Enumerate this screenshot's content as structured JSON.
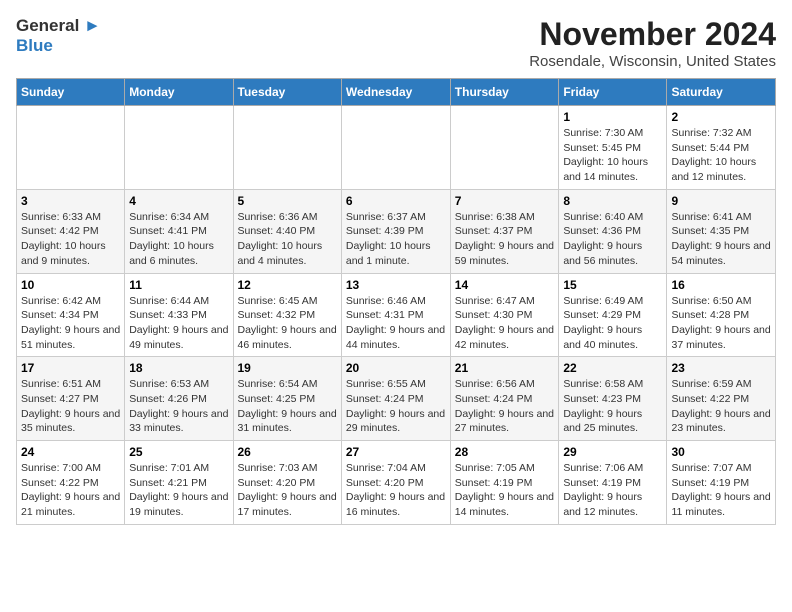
{
  "header": {
    "logo_line1": "General",
    "logo_line2": "Blue",
    "month": "November 2024",
    "location": "Rosendale, Wisconsin, United States"
  },
  "days_of_week": [
    "Sunday",
    "Monday",
    "Tuesday",
    "Wednesday",
    "Thursday",
    "Friday",
    "Saturday"
  ],
  "weeks": [
    [
      {
        "day": "",
        "info": ""
      },
      {
        "day": "",
        "info": ""
      },
      {
        "day": "",
        "info": ""
      },
      {
        "day": "",
        "info": ""
      },
      {
        "day": "",
        "info": ""
      },
      {
        "day": "1",
        "info": "Sunrise: 7:30 AM\nSunset: 5:45 PM\nDaylight: 10 hours and 14 minutes."
      },
      {
        "day": "2",
        "info": "Sunrise: 7:32 AM\nSunset: 5:44 PM\nDaylight: 10 hours and 12 minutes."
      }
    ],
    [
      {
        "day": "3",
        "info": "Sunrise: 6:33 AM\nSunset: 4:42 PM\nDaylight: 10 hours and 9 minutes."
      },
      {
        "day": "4",
        "info": "Sunrise: 6:34 AM\nSunset: 4:41 PM\nDaylight: 10 hours and 6 minutes."
      },
      {
        "day": "5",
        "info": "Sunrise: 6:36 AM\nSunset: 4:40 PM\nDaylight: 10 hours and 4 minutes."
      },
      {
        "day": "6",
        "info": "Sunrise: 6:37 AM\nSunset: 4:39 PM\nDaylight: 10 hours and 1 minute."
      },
      {
        "day": "7",
        "info": "Sunrise: 6:38 AM\nSunset: 4:37 PM\nDaylight: 9 hours and 59 minutes."
      },
      {
        "day": "8",
        "info": "Sunrise: 6:40 AM\nSunset: 4:36 PM\nDaylight: 9 hours and 56 minutes."
      },
      {
        "day": "9",
        "info": "Sunrise: 6:41 AM\nSunset: 4:35 PM\nDaylight: 9 hours and 54 minutes."
      }
    ],
    [
      {
        "day": "10",
        "info": "Sunrise: 6:42 AM\nSunset: 4:34 PM\nDaylight: 9 hours and 51 minutes."
      },
      {
        "day": "11",
        "info": "Sunrise: 6:44 AM\nSunset: 4:33 PM\nDaylight: 9 hours and 49 minutes."
      },
      {
        "day": "12",
        "info": "Sunrise: 6:45 AM\nSunset: 4:32 PM\nDaylight: 9 hours and 46 minutes."
      },
      {
        "day": "13",
        "info": "Sunrise: 6:46 AM\nSunset: 4:31 PM\nDaylight: 9 hours and 44 minutes."
      },
      {
        "day": "14",
        "info": "Sunrise: 6:47 AM\nSunset: 4:30 PM\nDaylight: 9 hours and 42 minutes."
      },
      {
        "day": "15",
        "info": "Sunrise: 6:49 AM\nSunset: 4:29 PM\nDaylight: 9 hours and 40 minutes."
      },
      {
        "day": "16",
        "info": "Sunrise: 6:50 AM\nSunset: 4:28 PM\nDaylight: 9 hours and 37 minutes."
      }
    ],
    [
      {
        "day": "17",
        "info": "Sunrise: 6:51 AM\nSunset: 4:27 PM\nDaylight: 9 hours and 35 minutes."
      },
      {
        "day": "18",
        "info": "Sunrise: 6:53 AM\nSunset: 4:26 PM\nDaylight: 9 hours and 33 minutes."
      },
      {
        "day": "19",
        "info": "Sunrise: 6:54 AM\nSunset: 4:25 PM\nDaylight: 9 hours and 31 minutes."
      },
      {
        "day": "20",
        "info": "Sunrise: 6:55 AM\nSunset: 4:24 PM\nDaylight: 9 hours and 29 minutes."
      },
      {
        "day": "21",
        "info": "Sunrise: 6:56 AM\nSunset: 4:24 PM\nDaylight: 9 hours and 27 minutes."
      },
      {
        "day": "22",
        "info": "Sunrise: 6:58 AM\nSunset: 4:23 PM\nDaylight: 9 hours and 25 minutes."
      },
      {
        "day": "23",
        "info": "Sunrise: 6:59 AM\nSunset: 4:22 PM\nDaylight: 9 hours and 23 minutes."
      }
    ],
    [
      {
        "day": "24",
        "info": "Sunrise: 7:00 AM\nSunset: 4:22 PM\nDaylight: 9 hours and 21 minutes."
      },
      {
        "day": "25",
        "info": "Sunrise: 7:01 AM\nSunset: 4:21 PM\nDaylight: 9 hours and 19 minutes."
      },
      {
        "day": "26",
        "info": "Sunrise: 7:03 AM\nSunset: 4:20 PM\nDaylight: 9 hours and 17 minutes."
      },
      {
        "day": "27",
        "info": "Sunrise: 7:04 AM\nSunset: 4:20 PM\nDaylight: 9 hours and 16 minutes."
      },
      {
        "day": "28",
        "info": "Sunrise: 7:05 AM\nSunset: 4:19 PM\nDaylight: 9 hours and 14 minutes."
      },
      {
        "day": "29",
        "info": "Sunrise: 7:06 AM\nSunset: 4:19 PM\nDaylight: 9 hours and 12 minutes."
      },
      {
        "day": "30",
        "info": "Sunrise: 7:07 AM\nSunset: 4:19 PM\nDaylight: 9 hours and 11 minutes."
      }
    ]
  ]
}
